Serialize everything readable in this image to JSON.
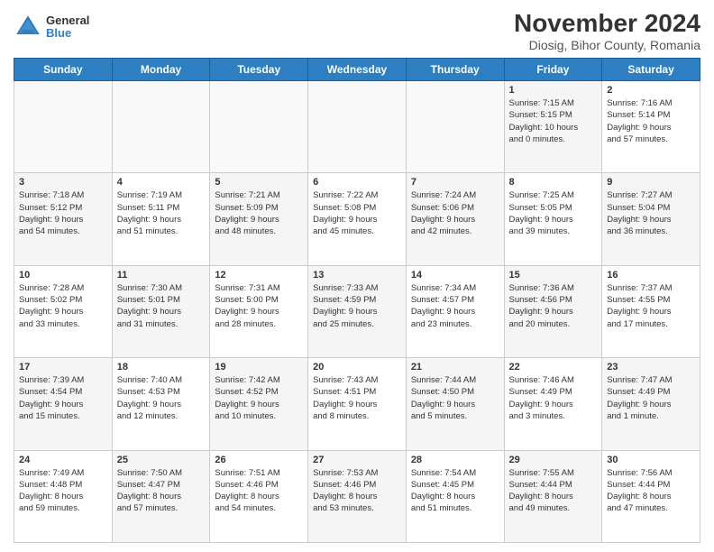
{
  "logo": {
    "general": "General",
    "blue": "Blue"
  },
  "title": "November 2024",
  "subtitle": "Diosig, Bihor County, Romania",
  "weekdays": [
    "Sunday",
    "Monday",
    "Tuesday",
    "Wednesday",
    "Thursday",
    "Friday",
    "Saturday"
  ],
  "weeks": [
    [
      {
        "day": "",
        "info": "",
        "empty": true
      },
      {
        "day": "",
        "info": "",
        "empty": true
      },
      {
        "day": "",
        "info": "",
        "empty": true
      },
      {
        "day": "",
        "info": "",
        "empty": true
      },
      {
        "day": "",
        "info": "",
        "empty": true
      },
      {
        "day": "1",
        "info": "Sunrise: 7:15 AM\nSunset: 5:15 PM\nDaylight: 10 hours\nand 0 minutes.",
        "shaded": true
      },
      {
        "day": "2",
        "info": "Sunrise: 7:16 AM\nSunset: 5:14 PM\nDaylight: 9 hours\nand 57 minutes.",
        "shaded": false
      }
    ],
    [
      {
        "day": "3",
        "info": "Sunrise: 7:18 AM\nSunset: 5:12 PM\nDaylight: 9 hours\nand 54 minutes.",
        "shaded": true
      },
      {
        "day": "4",
        "info": "Sunrise: 7:19 AM\nSunset: 5:11 PM\nDaylight: 9 hours\nand 51 minutes.",
        "shaded": false
      },
      {
        "day": "5",
        "info": "Sunrise: 7:21 AM\nSunset: 5:09 PM\nDaylight: 9 hours\nand 48 minutes.",
        "shaded": true
      },
      {
        "day": "6",
        "info": "Sunrise: 7:22 AM\nSunset: 5:08 PM\nDaylight: 9 hours\nand 45 minutes.",
        "shaded": false
      },
      {
        "day": "7",
        "info": "Sunrise: 7:24 AM\nSunset: 5:06 PM\nDaylight: 9 hours\nand 42 minutes.",
        "shaded": true
      },
      {
        "day": "8",
        "info": "Sunrise: 7:25 AM\nSunset: 5:05 PM\nDaylight: 9 hours\nand 39 minutes.",
        "shaded": false
      },
      {
        "day": "9",
        "info": "Sunrise: 7:27 AM\nSunset: 5:04 PM\nDaylight: 9 hours\nand 36 minutes.",
        "shaded": true
      }
    ],
    [
      {
        "day": "10",
        "info": "Sunrise: 7:28 AM\nSunset: 5:02 PM\nDaylight: 9 hours\nand 33 minutes.",
        "shaded": false
      },
      {
        "day": "11",
        "info": "Sunrise: 7:30 AM\nSunset: 5:01 PM\nDaylight: 9 hours\nand 31 minutes.",
        "shaded": true
      },
      {
        "day": "12",
        "info": "Sunrise: 7:31 AM\nSunset: 5:00 PM\nDaylight: 9 hours\nand 28 minutes.",
        "shaded": false
      },
      {
        "day": "13",
        "info": "Sunrise: 7:33 AM\nSunset: 4:59 PM\nDaylight: 9 hours\nand 25 minutes.",
        "shaded": true
      },
      {
        "day": "14",
        "info": "Sunrise: 7:34 AM\nSunset: 4:57 PM\nDaylight: 9 hours\nand 23 minutes.",
        "shaded": false
      },
      {
        "day": "15",
        "info": "Sunrise: 7:36 AM\nSunset: 4:56 PM\nDaylight: 9 hours\nand 20 minutes.",
        "shaded": true
      },
      {
        "day": "16",
        "info": "Sunrise: 7:37 AM\nSunset: 4:55 PM\nDaylight: 9 hours\nand 17 minutes.",
        "shaded": false
      }
    ],
    [
      {
        "day": "17",
        "info": "Sunrise: 7:39 AM\nSunset: 4:54 PM\nDaylight: 9 hours\nand 15 minutes.",
        "shaded": true
      },
      {
        "day": "18",
        "info": "Sunrise: 7:40 AM\nSunset: 4:53 PM\nDaylight: 9 hours\nand 12 minutes.",
        "shaded": false
      },
      {
        "day": "19",
        "info": "Sunrise: 7:42 AM\nSunset: 4:52 PM\nDaylight: 9 hours\nand 10 minutes.",
        "shaded": true
      },
      {
        "day": "20",
        "info": "Sunrise: 7:43 AM\nSunset: 4:51 PM\nDaylight: 9 hours\nand 8 minutes.",
        "shaded": false
      },
      {
        "day": "21",
        "info": "Sunrise: 7:44 AM\nSunset: 4:50 PM\nDaylight: 9 hours\nand 5 minutes.",
        "shaded": true
      },
      {
        "day": "22",
        "info": "Sunrise: 7:46 AM\nSunset: 4:49 PM\nDaylight: 9 hours\nand 3 minutes.",
        "shaded": false
      },
      {
        "day": "23",
        "info": "Sunrise: 7:47 AM\nSunset: 4:49 PM\nDaylight: 9 hours\nand 1 minute.",
        "shaded": true
      }
    ],
    [
      {
        "day": "24",
        "info": "Sunrise: 7:49 AM\nSunset: 4:48 PM\nDaylight: 8 hours\nand 59 minutes.",
        "shaded": false
      },
      {
        "day": "25",
        "info": "Sunrise: 7:50 AM\nSunset: 4:47 PM\nDaylight: 8 hours\nand 57 minutes.",
        "shaded": true
      },
      {
        "day": "26",
        "info": "Sunrise: 7:51 AM\nSunset: 4:46 PM\nDaylight: 8 hours\nand 54 minutes.",
        "shaded": false
      },
      {
        "day": "27",
        "info": "Sunrise: 7:53 AM\nSunset: 4:46 PM\nDaylight: 8 hours\nand 53 minutes.",
        "shaded": true
      },
      {
        "day": "28",
        "info": "Sunrise: 7:54 AM\nSunset: 4:45 PM\nDaylight: 8 hours\nand 51 minutes.",
        "shaded": false
      },
      {
        "day": "29",
        "info": "Sunrise: 7:55 AM\nSunset: 4:44 PM\nDaylight: 8 hours\nand 49 minutes.",
        "shaded": true
      },
      {
        "day": "30",
        "info": "Sunrise: 7:56 AM\nSunset: 4:44 PM\nDaylight: 8 hours\nand 47 minutes.",
        "shaded": false
      }
    ]
  ]
}
